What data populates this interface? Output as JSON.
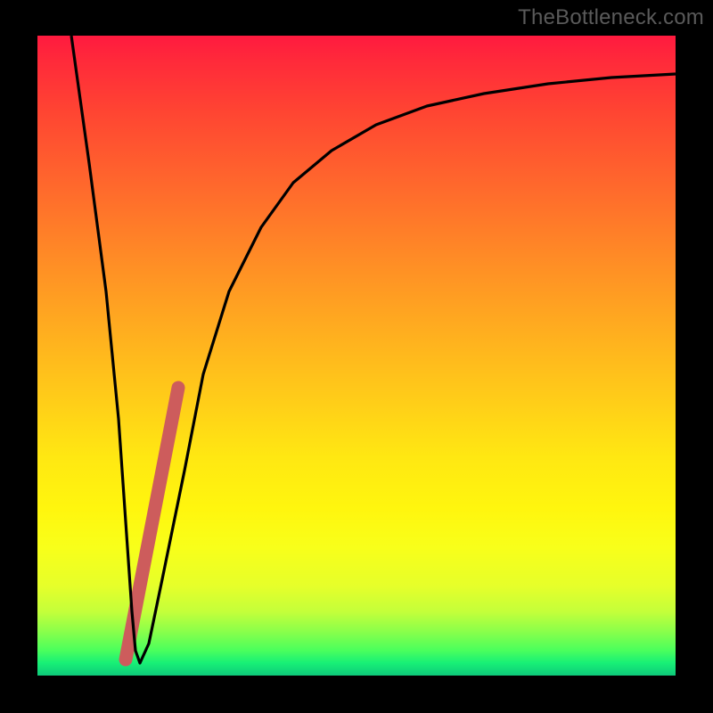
{
  "watermark": "TheBottleneck.com",
  "colors": {
    "frame": "#000000",
    "curve": "#000000",
    "highlight": "#cd5c5c",
    "gradient_top": "#ff1a3f",
    "gradient_bottom": "#0ec97a"
  },
  "chart_data": {
    "type": "line",
    "title": "",
    "xlabel": "",
    "ylabel": "",
    "xlim": [
      0,
      100
    ],
    "ylim": [
      0,
      100
    ],
    "grid": false,
    "legend": false,
    "series": [
      {
        "name": "bottleneck-curve",
        "x": [
          0,
          3,
          6,
          9,
          12,
          14,
          16,
          18,
          20,
          23,
          26,
          30,
          35,
          40,
          46,
          53,
          61,
          70,
          80,
          90,
          100
        ],
        "y": [
          100,
          80,
          60,
          40,
          20,
          7,
          2,
          5,
          15,
          32,
          47,
          60,
          70,
          77,
          82,
          86,
          89,
          91,
          92.5,
          93.5,
          94
        ]
      }
    ],
    "annotations": [
      {
        "name": "highlight-segment",
        "type": "line",
        "x": [
          13.8,
          22.0
        ],
        "y": [
          2.5,
          45.0
        ],
        "stroke": "#cd5c5c",
        "width": 15
      }
    ]
  }
}
